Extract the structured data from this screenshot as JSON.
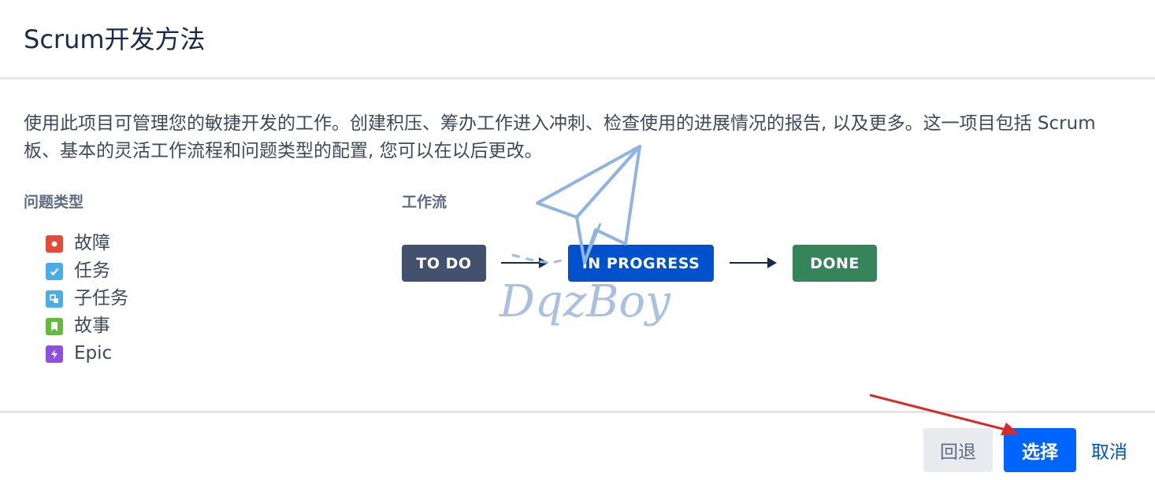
{
  "dialog": {
    "title": "Scrum开发方法",
    "description": "使用此项目可管理您的敏捷开发的工作。创建积压、筹办工作进入冲刺、检查使用的进展情况的报告, 以及更多。这一项目包括 Scrum 板、基本的灵活工作流程和问题类型的配置, 您可以在以后更改。"
  },
  "issue_types": {
    "label": "问题类型",
    "items": [
      {
        "name": "故障",
        "icon": "bug-icon",
        "color": "#e5493a"
      },
      {
        "name": "任务",
        "icon": "task-icon",
        "color": "#4bade8"
      },
      {
        "name": "子任务",
        "icon": "subtask-icon",
        "color": "#4bade8"
      },
      {
        "name": "故事",
        "icon": "story-icon",
        "color": "#63ba3c"
      },
      {
        "name": "Epic",
        "icon": "epic-icon",
        "color": "#904ee2"
      }
    ]
  },
  "workflow": {
    "label": "工作流",
    "statuses": [
      {
        "name": "TO DO",
        "color": "#42526e"
      },
      {
        "name": "IN PROGRESS",
        "color": "#0052cc"
      },
      {
        "name": "DONE",
        "color": "#36855a"
      }
    ]
  },
  "watermark": {
    "text": "DqzBoy"
  },
  "footer": {
    "back_label": "回退",
    "select_label": "选择",
    "cancel_label": "取消"
  }
}
